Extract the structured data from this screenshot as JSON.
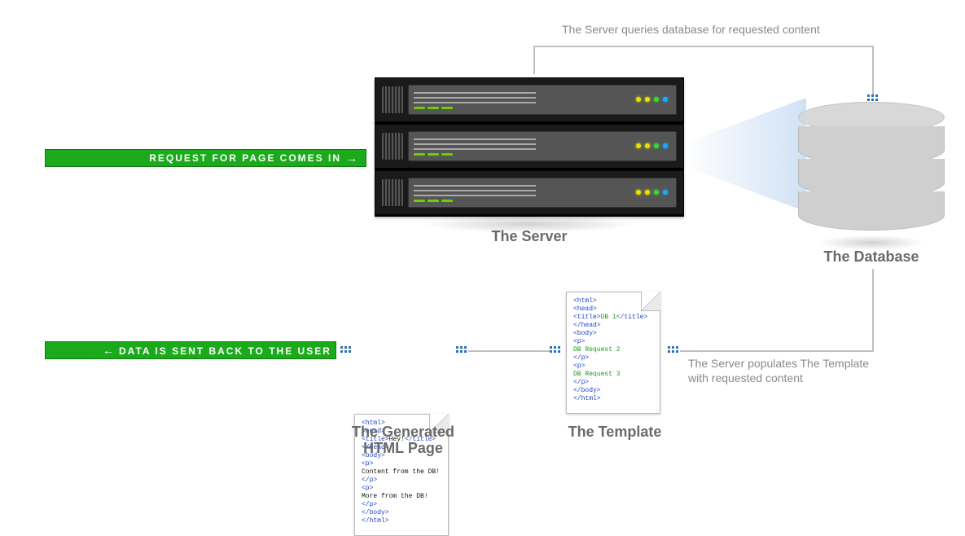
{
  "banners": {
    "request_in": "REQUEST FOR PAGE COMES IN",
    "data_out": "DATA IS SENT BACK TO THE USER"
  },
  "captions": {
    "server": "The Server",
    "database": "The Database",
    "generated": "The Generated",
    "generated2": "HTML Page",
    "template": "The Template"
  },
  "notes": {
    "query": "The Server queries database for requested content",
    "popul1": "The Server populates The Template",
    "popul2": "with requested content"
  },
  "file_generated": {
    "l1": "<html>",
    "l2": " <head>",
    "l3": "  <title>",
    "l3b": "Hey!",
    "l3c": "</title>",
    "l4": " </head>",
    "l5": " <body>",
    "l6": "  <p>",
    "l7": "   Content from the DB!",
    "l8": "  </p>",
    "l9": "  <p>",
    "l10": "   More from the DB!",
    "l11": "  </p>",
    "l12": " </body>",
    "l13": "</html>"
  },
  "file_template": {
    "l1": "<html>",
    "l2": " <head>",
    "l3": "  <title>",
    "l3b": "DB 1",
    "l3c": "</title>",
    "l4": " </head>",
    "l5": " <body>",
    "l6": "  <p>",
    "l7": "   DB Request 2",
    "l8": "  </p>",
    "l9": "  <p>",
    "l10": "   DB Request 3",
    "l11": "  </p>",
    "l12": " </body>",
    "l13": "</html>"
  }
}
